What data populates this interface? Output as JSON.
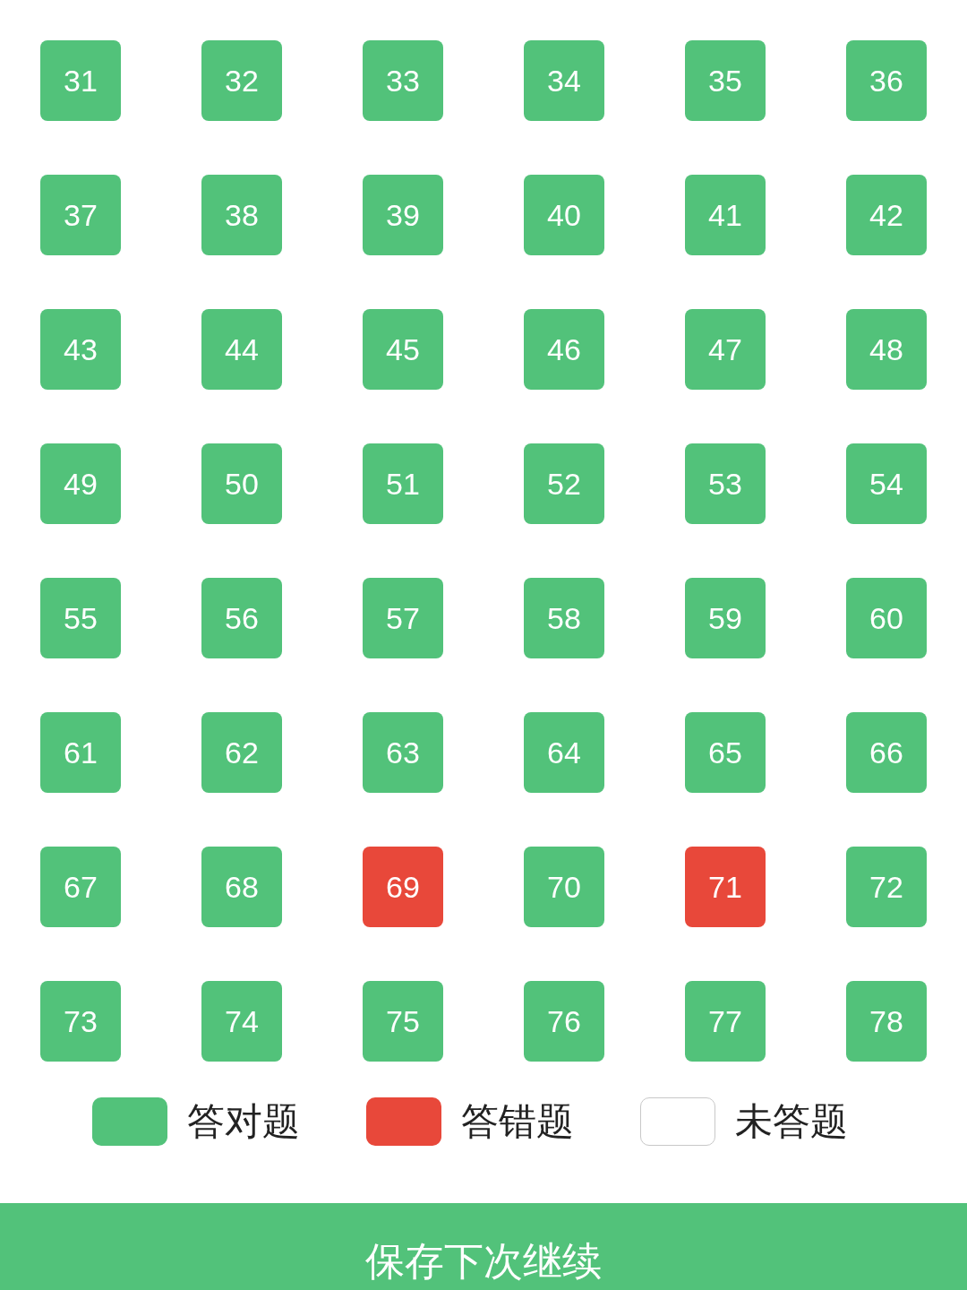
{
  "questions": [
    {
      "number": "31",
      "kind": "correct"
    },
    {
      "number": "32",
      "kind": "correct"
    },
    {
      "number": "33",
      "kind": "correct"
    },
    {
      "number": "34",
      "kind": "correct"
    },
    {
      "number": "35",
      "kind": "correct"
    },
    {
      "number": "36",
      "kind": "correct"
    },
    {
      "number": "37",
      "kind": "correct"
    },
    {
      "number": "38",
      "kind": "correct"
    },
    {
      "number": "39",
      "kind": "correct"
    },
    {
      "number": "40",
      "kind": "correct"
    },
    {
      "number": "41",
      "kind": "correct"
    },
    {
      "number": "42",
      "kind": "correct"
    },
    {
      "number": "43",
      "kind": "correct"
    },
    {
      "number": "44",
      "kind": "correct"
    },
    {
      "number": "45",
      "kind": "correct"
    },
    {
      "number": "46",
      "kind": "correct"
    },
    {
      "number": "47",
      "kind": "correct"
    },
    {
      "number": "48",
      "kind": "correct"
    },
    {
      "number": "49",
      "kind": "correct"
    },
    {
      "number": "50",
      "kind": "correct"
    },
    {
      "number": "51",
      "kind": "correct"
    },
    {
      "number": "52",
      "kind": "correct"
    },
    {
      "number": "53",
      "kind": "correct"
    },
    {
      "number": "54",
      "kind": "correct"
    },
    {
      "number": "55",
      "kind": "correct"
    },
    {
      "number": "56",
      "kind": "correct"
    },
    {
      "number": "57",
      "kind": "correct"
    },
    {
      "number": "58",
      "kind": "correct"
    },
    {
      "number": "59",
      "kind": "correct"
    },
    {
      "number": "60",
      "kind": "correct"
    },
    {
      "number": "61",
      "kind": "correct"
    },
    {
      "number": "62",
      "kind": "correct"
    },
    {
      "number": "63",
      "kind": "correct"
    },
    {
      "number": "64",
      "kind": "correct"
    },
    {
      "number": "65",
      "kind": "correct"
    },
    {
      "number": "66",
      "kind": "correct"
    },
    {
      "number": "67",
      "kind": "correct"
    },
    {
      "number": "68",
      "kind": "correct"
    },
    {
      "number": "69",
      "kind": "wrong"
    },
    {
      "number": "70",
      "kind": "correct"
    },
    {
      "number": "71",
      "kind": "wrong"
    },
    {
      "number": "72",
      "kind": "correct"
    },
    {
      "number": "73",
      "kind": "correct"
    },
    {
      "number": "74",
      "kind": "correct"
    },
    {
      "number": "75",
      "kind": "correct"
    },
    {
      "number": "76",
      "kind": "correct"
    },
    {
      "number": "77",
      "kind": "correct"
    },
    {
      "number": "78",
      "kind": "correct"
    }
  ],
  "legend": [
    {
      "kind": "correct",
      "label": "答对题"
    },
    {
      "kind": "wrong",
      "label": "答错题"
    },
    {
      "kind": "unanswered",
      "label": "未答题"
    }
  ],
  "save_button": "保存下次继续"
}
